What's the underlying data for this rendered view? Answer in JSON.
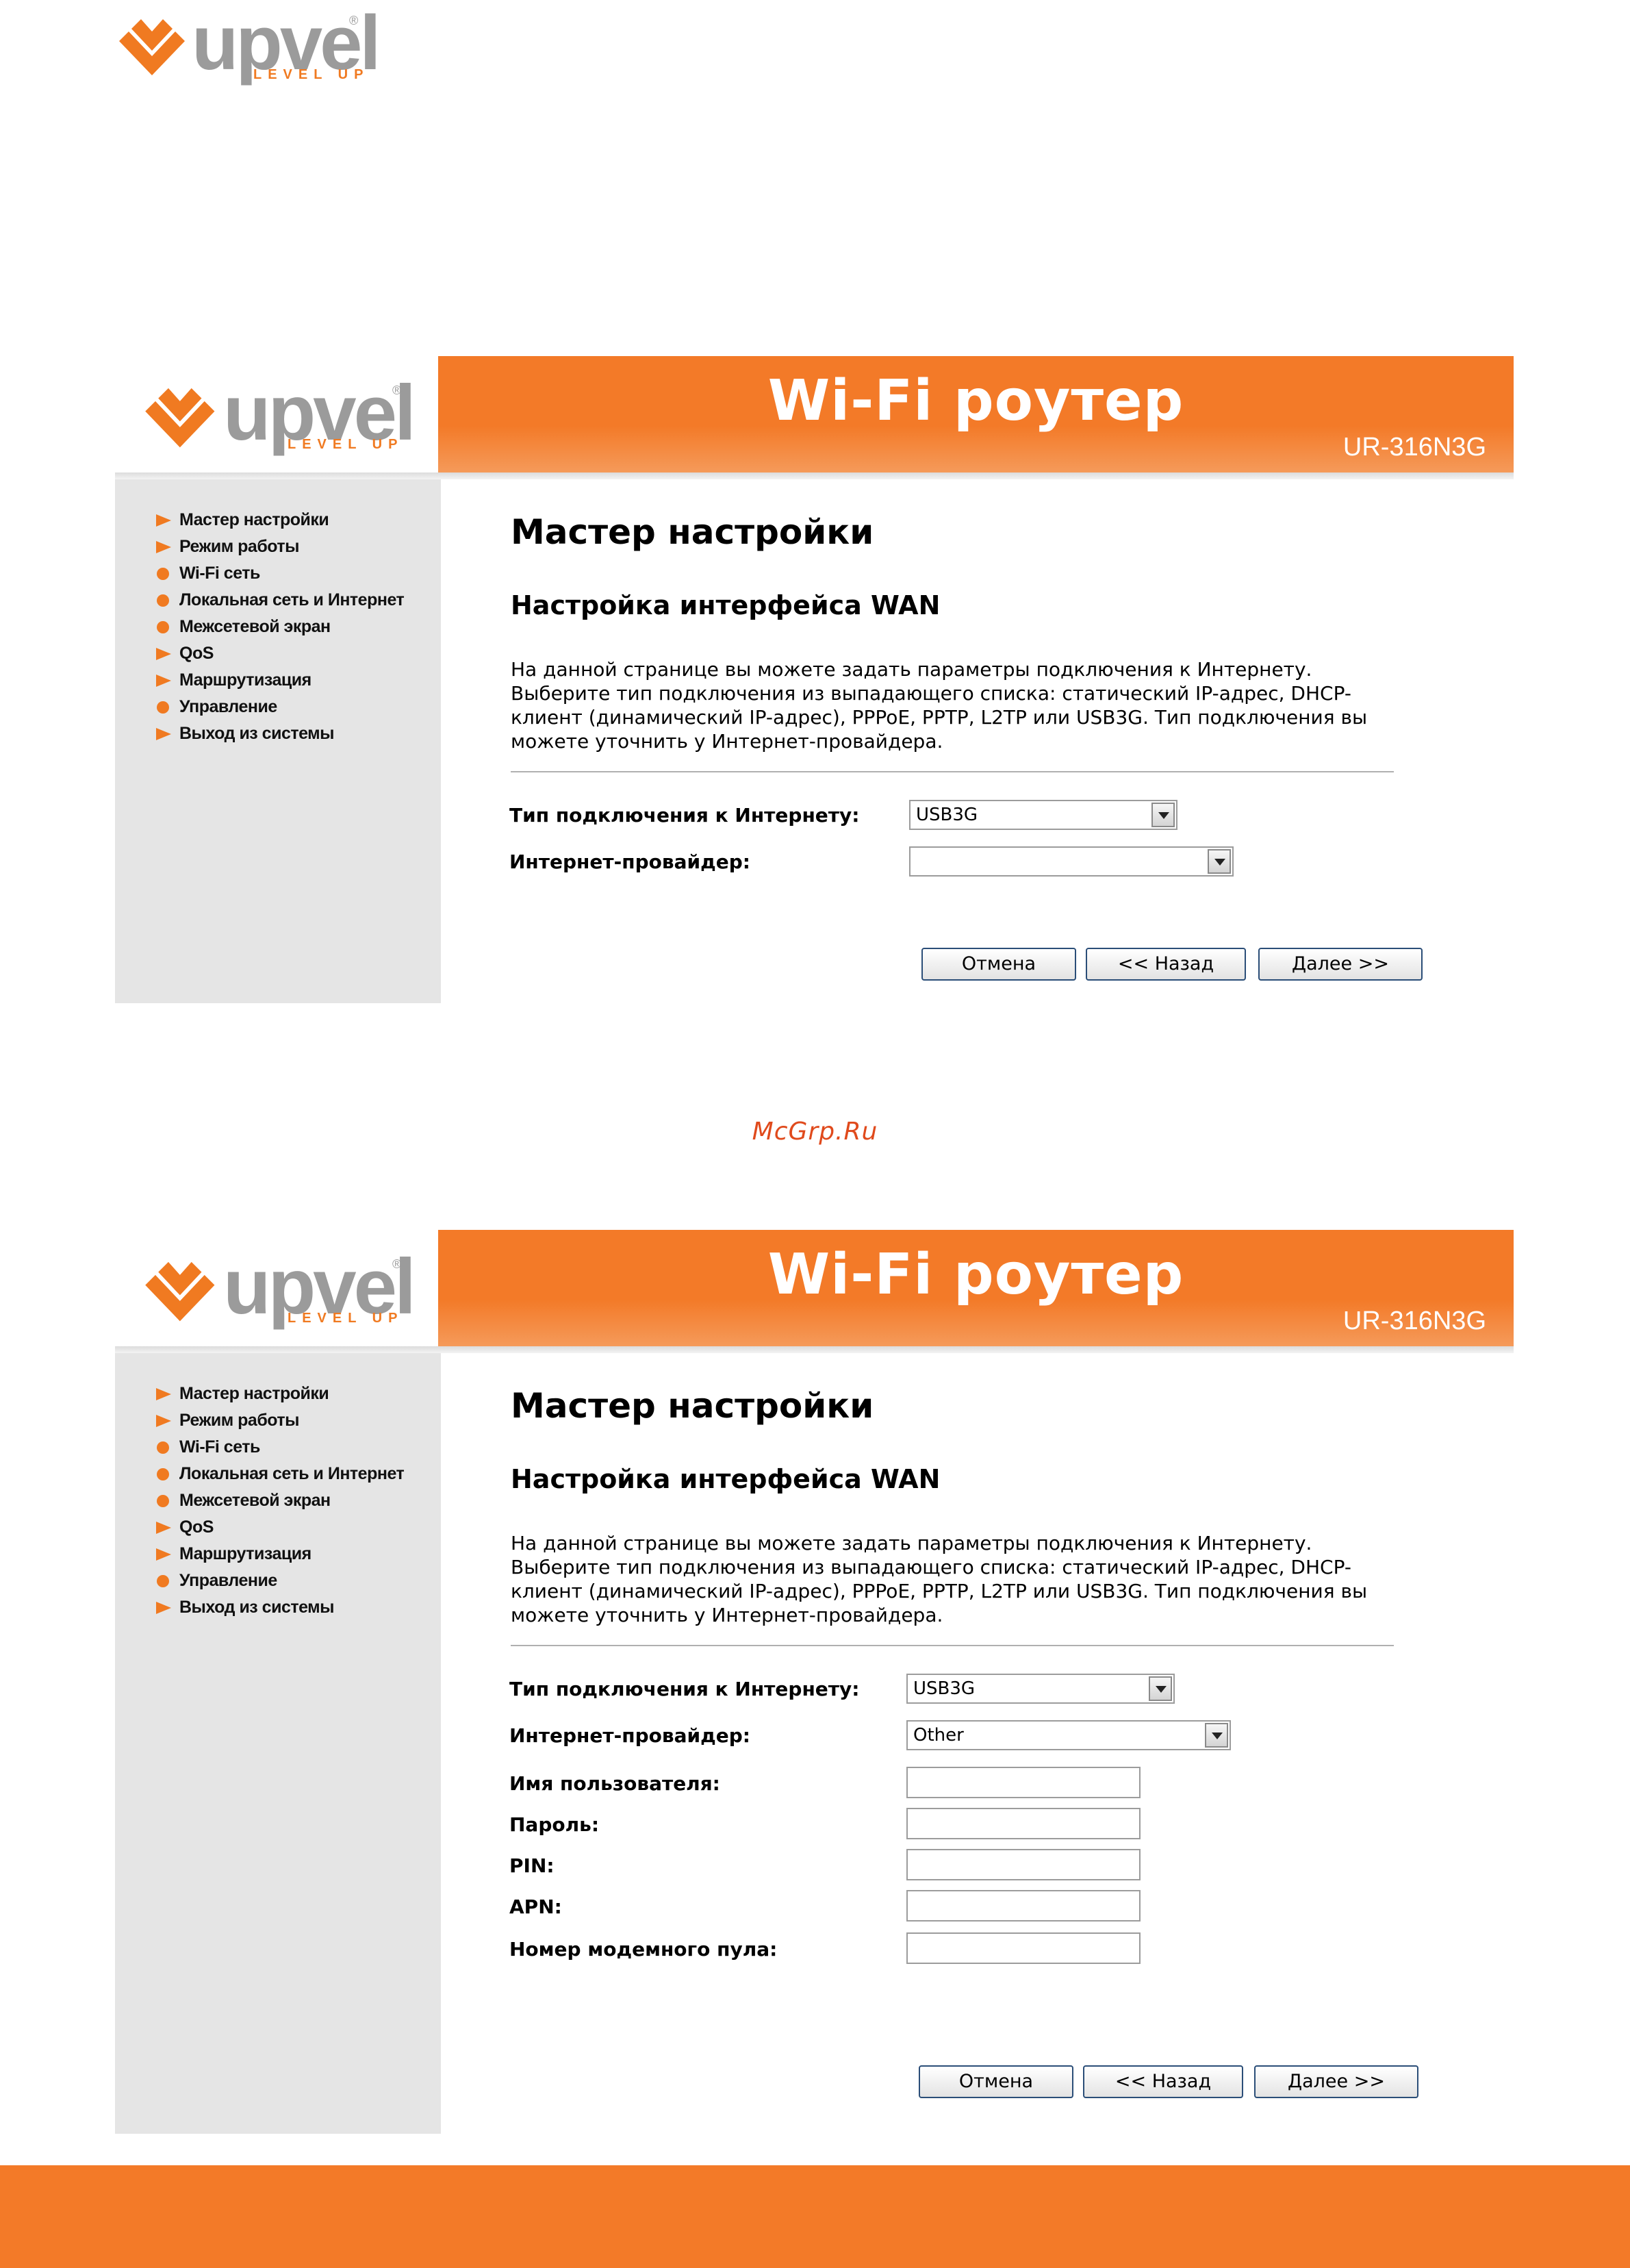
{
  "brand": {
    "name": "upvel",
    "tagline": "LEVEL UP",
    "registered": "®",
    "logo_icon": "upvel-chevron-logo-icon"
  },
  "colors": {
    "accent": "#f37a28",
    "sidebar_bg": "#e5e5e5",
    "watermark": "#e04a1c"
  },
  "watermark": "McGrp.Ru",
  "screens": [
    {
      "header": {
        "title": "Wi-Fi роутер",
        "model": "UR-316N3G"
      },
      "sidebar": {
        "items": [
          {
            "label": "Мастер настройки",
            "icon": "triangle"
          },
          {
            "label": "Режим работы",
            "icon": "triangle"
          },
          {
            "label": "Wi-Fi сеть",
            "icon": "dot"
          },
          {
            "label": "Локальная сеть и Интернет",
            "icon": "dot"
          },
          {
            "label": "Межсетевой экран",
            "icon": "dot"
          },
          {
            "label": "QoS",
            "icon": "triangle"
          },
          {
            "label": "Маршрутизация",
            "icon": "triangle"
          },
          {
            "label": "Управление",
            "icon": "dot"
          },
          {
            "label": "Выход из системы",
            "icon": "triangle"
          }
        ]
      },
      "main": {
        "title": "Мастер настройки",
        "subtitle": "Настройка интерфейса WAN",
        "description": [
          "На данной странице вы можете задать параметры подключения к Интернету.",
          "Выберите тип подключения из выпадающего списка: статический IP-адрес, DHCP-",
          "клиент (динамический IP-адрес), PPPoE, PPTP, L2TP или USB3G. Тип подключения вы",
          "можете уточнить у Интернет-провайдера."
        ],
        "fields": {
          "connection_type_label": "Тип подключения к Интернету:",
          "connection_type_value": "USB3G",
          "provider_label": "Интернет-провайдер:",
          "provider_value": ""
        },
        "buttons": {
          "cancel": "Отмена",
          "back": "<< Назад",
          "next": "Далее >>"
        }
      }
    },
    {
      "header": {
        "title": "Wi-Fi роутер",
        "model": "UR-316N3G"
      },
      "sidebar": {
        "items": [
          {
            "label": "Мастер настройки",
            "icon": "triangle"
          },
          {
            "label": "Режим работы",
            "icon": "triangle"
          },
          {
            "label": "Wi-Fi сеть",
            "icon": "dot"
          },
          {
            "label": "Локальная сеть и Интернет",
            "icon": "dot"
          },
          {
            "label": "Межсетевой экран",
            "icon": "dot"
          },
          {
            "label": "QoS",
            "icon": "triangle"
          },
          {
            "label": "Маршрутизация",
            "icon": "triangle"
          },
          {
            "label": "Управление",
            "icon": "dot"
          },
          {
            "label": "Выход из системы",
            "icon": "triangle"
          }
        ]
      },
      "main": {
        "title": "Мастер настройки",
        "subtitle": "Настройка интерфейса WAN",
        "description": [
          "На данной странице вы можете задать параметры подключения к Интернету.",
          "Выберите тип подключения из выпадающего списка: статический IP-адрес, DHCP-",
          "клиент (динамический IP-адрес), PPPoE, PPTP, L2TP или USB3G. Тип подключения вы",
          "можете уточнить у Интернет-провайдера."
        ],
        "fields": {
          "connection_type_label": "Тип подключения к Интернету:",
          "connection_type_value": "USB3G",
          "provider_label": "Интернет-провайдер:",
          "provider_value": "Other",
          "username_label": "Имя пользователя:",
          "username_value": "",
          "password_label": "Пароль:",
          "password_value": "",
          "pin_label": "PIN:",
          "pin_value": "",
          "apn_label": "APN:",
          "apn_value": "",
          "dial_label": "Номер модемного пула:",
          "dial_value": ""
        },
        "buttons": {
          "cancel": "Отмена",
          "back": "<< Назад",
          "next": "Далее >>"
        }
      }
    }
  ]
}
